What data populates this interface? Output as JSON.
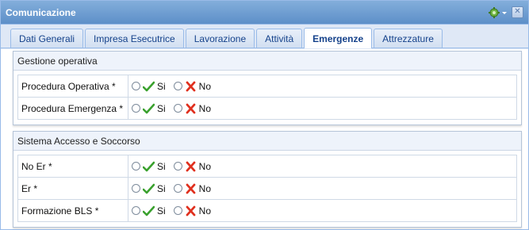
{
  "window": {
    "title": "Comunicazione"
  },
  "tabs": [
    {
      "label": "Dati Generali",
      "active": false
    },
    {
      "label": "Impresa Esecutrice",
      "active": false
    },
    {
      "label": "Lavorazione",
      "active": false
    },
    {
      "label": "Attività",
      "active": false
    },
    {
      "label": "Emergenze",
      "active": true
    },
    {
      "label": "Attrezzature",
      "active": false
    }
  ],
  "sections": [
    {
      "title": "Gestione operativa",
      "rows": [
        {
          "label": "Procedura Operativa *",
          "yes": "Si",
          "no": "No"
        },
        {
          "label": "Procedura Emergenza *",
          "yes": "Si",
          "no": "No"
        }
      ]
    },
    {
      "title": "Sistema Accesso e Soccorso",
      "rows": [
        {
          "label": "No Er *",
          "yes": "Si",
          "no": "No"
        },
        {
          "label": "Er *",
          "yes": "Si",
          "no": "No"
        },
        {
          "label": "Formazione BLS *",
          "yes": "Si",
          "no": "No"
        }
      ]
    }
  ],
  "colors": {
    "titlebar": "#5d8fc8",
    "tab_text": "#15428b",
    "check": "#3aa12e",
    "cross": "#e0301e"
  }
}
